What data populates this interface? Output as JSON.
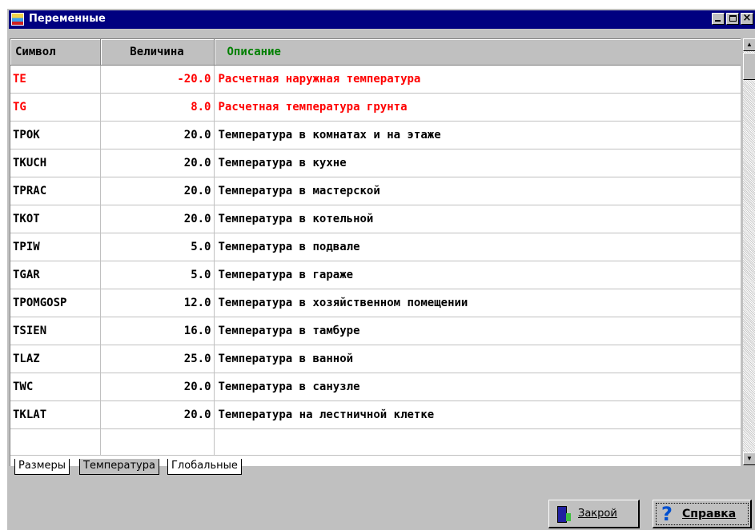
{
  "window": {
    "title": "Переменные"
  },
  "grid": {
    "columns": [
      "Символ",
      "Величина",
      "Описание"
    ],
    "rows": [
      {
        "symbol": "TE",
        "value": "-20.0",
        "description": "Расчетная наружная температура",
        "highlight": true
      },
      {
        "symbol": "TG",
        "value": "8.0",
        "description": "Расчетная температура грунта",
        "highlight": true
      },
      {
        "symbol": "TPOK",
        "value": "20.0",
        "description": "Температура в комнатах и на этаже"
      },
      {
        "symbol": "TKUCH",
        "value": "20.0",
        "description": "Температура в кухне"
      },
      {
        "symbol": "TPRAC",
        "value": "20.0",
        "description": "Температура в мастерской"
      },
      {
        "symbol": "TKOT",
        "value": "20.0",
        "description": "Температура в котельной"
      },
      {
        "symbol": "TPIW",
        "value": "5.0",
        "description": "Температура в подвале"
      },
      {
        "symbol": "TGAR",
        "value": "5.0",
        "description": "Температура в гараже"
      },
      {
        "symbol": "TPOMGOSP",
        "value": "12.0",
        "description": "Температура в хозяйственном помещении"
      },
      {
        "symbol": "TSIEN",
        "value": "16.0",
        "description": "Температура в тамбуре"
      },
      {
        "symbol": "TLAZ",
        "value": "25.0",
        "description": "Температура в ванной"
      },
      {
        "symbol": "TWC",
        "value": "20.0",
        "description": "Температура в санузле"
      },
      {
        "symbol": "TKLAT",
        "value": "20.0",
        "description": "Температура на лестничной клетке"
      }
    ]
  },
  "tabs": [
    {
      "label": "Размеры"
    },
    {
      "label": "Температура",
      "selected": true
    },
    {
      "label": "Глобальные"
    }
  ],
  "buttons": {
    "close_label": "Закрой",
    "help_label": "Справка"
  },
  "colors": {
    "titlebar": "#000080",
    "highlight_text": "#ff0000",
    "header_desc": "#008000"
  }
}
